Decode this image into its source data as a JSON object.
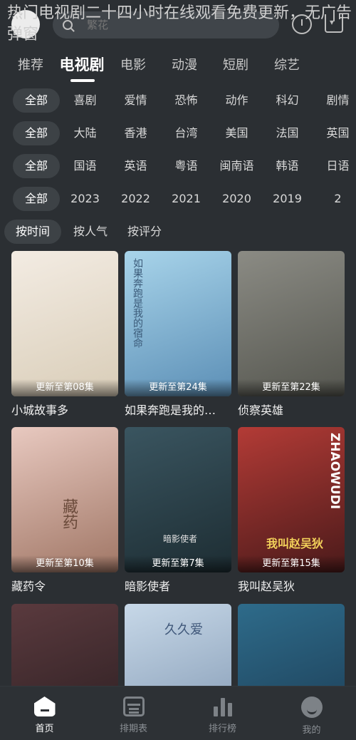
{
  "overlay": {
    "title": "热门电视剧二十四小时在线观看免费更新，无广告弹窗"
  },
  "header": {
    "search_placeholder": "繁花"
  },
  "tabs": [
    "推荐",
    "电视剧",
    "电影",
    "动漫",
    "短剧",
    "综艺"
  ],
  "active_tab": "电视剧",
  "filters": {
    "genre": {
      "all": "全部",
      "items": [
        "喜剧",
        "爱情",
        "恐怖",
        "动作",
        "科幻",
        "剧情"
      ]
    },
    "region": {
      "all": "全部",
      "items": [
        "大陆",
        "香港",
        "台湾",
        "美国",
        "法国",
        "英国"
      ]
    },
    "language": {
      "all": "全部",
      "items": [
        "国语",
        "英语",
        "粤语",
        "闽南语",
        "韩语",
        "日语"
      ]
    },
    "year": {
      "all": "全部",
      "items": [
        "2023",
        "2022",
        "2021",
        "2020",
        "2019",
        "2"
      ]
    },
    "sort": [
      "按时间",
      "按人气",
      "按评分"
    ]
  },
  "cards": [
    {
      "title": "小城故事多",
      "badge": "更新至第08集",
      "colors": [
        "#f3ece3",
        "#d9cdb8"
      ]
    },
    {
      "title": "如果奔跑是我的…",
      "badge": "更新至第24集",
      "colors": [
        "#a8d4ea",
        "#5c8fb6"
      ]
    },
    {
      "title": "侦察英雄",
      "badge": "更新至第22集",
      "colors": [
        "#8b8b84",
        "#55564f"
      ]
    },
    {
      "title": "藏药令",
      "badge": "更新至第10集",
      "colors": [
        "#e8c9c0",
        "#a07665"
      ]
    },
    {
      "title": "暗影使者",
      "badge": "更新至第7集",
      "colors": [
        "#3a5560",
        "#1d2d33"
      ]
    },
    {
      "title": "我叫赵吴狄",
      "badge": "更新至第15集",
      "colors": [
        "#b33b36",
        "#4a1a1a"
      ]
    },
    {
      "title": "",
      "badge": "",
      "colors": [
        "#5a3a3e",
        "#2a1d20"
      ]
    },
    {
      "title": "",
      "badge": "",
      "colors": [
        "#c7d8e8",
        "#7e95b0"
      ]
    },
    {
      "title": "",
      "badge": "",
      "colors": [
        "#2e6b8a",
        "#1b3a52"
      ]
    }
  ],
  "poster_text": {
    "card2": "如果奔跑是我的宿命",
    "card4": "藏药",
    "card5": "暗影使者",
    "card6": "我叫赵吴狄",
    "card6_side": "ZHAOWUDI",
    "card8": "久久爱"
  },
  "bottom_nav": [
    {
      "label": "首页",
      "active": true
    },
    {
      "label": "排期表",
      "active": false
    },
    {
      "label": "排行榜",
      "active": false
    },
    {
      "label": "我的",
      "active": false
    }
  ]
}
